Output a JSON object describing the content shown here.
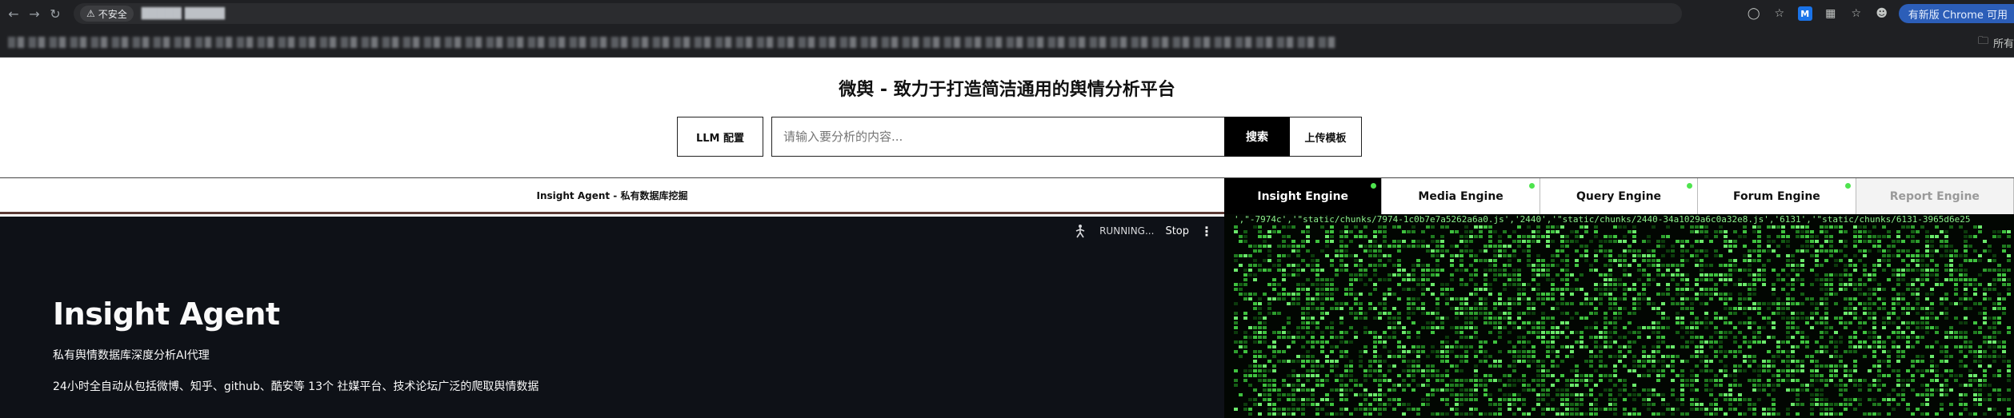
{
  "browser": {
    "security_label": "不安全",
    "url_blurred": "█████ █████",
    "update_label": "有新版 Chrome 可用",
    "bookmarks_folder": "所有"
  },
  "app": {
    "title": "微舆 - 致力于打造简洁通用的舆情分析平台",
    "llm_button": "LLM 配置",
    "search_placeholder": "请输入要分析的内容...",
    "search_button": "搜索",
    "upload_button": "上传模板"
  },
  "left_panel": {
    "header": "Insight Agent - 私有数据库挖掘",
    "status": "RUNNING...",
    "stop": "Stop",
    "agent_title": "Insight Agent",
    "agent_subtitle": "私有舆情数据库深度分析AI代理",
    "agent_description": "24小时全自动从包括微博、知乎、github、酷安等 13个 社媒平台、技术论坛广泛的爬取舆情数据"
  },
  "tabs": [
    {
      "label": "Insight Engine",
      "state": "active",
      "online": true
    },
    {
      "label": "Media Engine",
      "state": "normal",
      "online": true
    },
    {
      "label": "Query Engine",
      "state": "normal",
      "online": true
    },
    {
      "label": "Forum Engine",
      "state": "normal",
      "online": true
    },
    {
      "label": "Report Engine",
      "state": "disabled",
      "online": false
    }
  ],
  "console": {
    "first_line": "',\"-7974c','\"static/chunks/7974-1c0b7e7a5262a6a0.js','2440','\"static/chunks/2440-34a1029a6c0a32e8.js','6131','\"static/chunks/6131-3965d6e25",
    "text_color": "#8cf08c"
  },
  "colors": {
    "accent_green": "#4ee44e",
    "dark_bg": "#0e1117"
  }
}
